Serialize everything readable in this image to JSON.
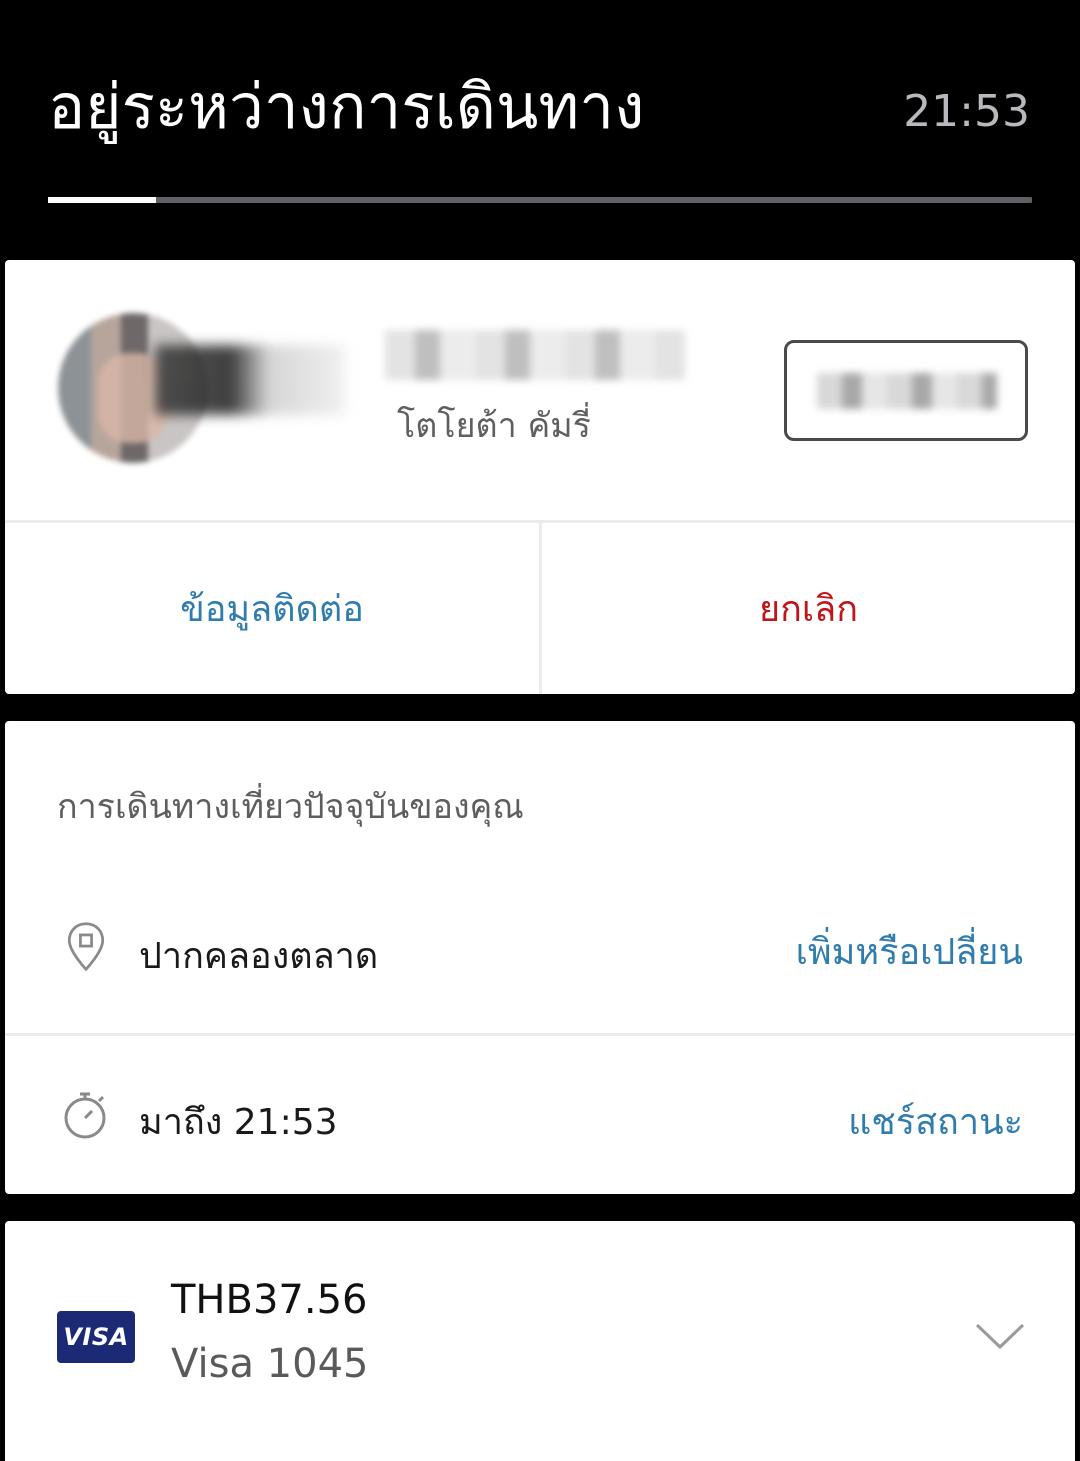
{
  "header": {
    "title": "อยู่ระหว่างการเดินทาง",
    "time": "21:53",
    "progress_fraction": 0.11
  },
  "driver": {
    "vehicle_model": "โตโยต้า คัมรี่",
    "contact_label": "ข้อมูลติดต่อ",
    "cancel_label": "ยกเลิก"
  },
  "trip": {
    "heading": "การเดินทางเที่ยวปัจจุบันของคุณ",
    "destination": "ปากคลองตลาด",
    "destination_action": "เพิ่มหรือเปลี่ยน",
    "arrival": "มาถึง 21:53",
    "arrival_action": "แชร์สถานะ"
  },
  "payment": {
    "brand": "VISA",
    "amount": "THB37.56",
    "card": "Visa 1045"
  },
  "colors": {
    "link": "#2f7cad",
    "cancel": "#c0161b",
    "visa": "#1a2a75"
  },
  "icons": {
    "destination": "map-pin-icon",
    "arrival": "stopwatch-icon",
    "expand": "chevron-down-icon"
  }
}
